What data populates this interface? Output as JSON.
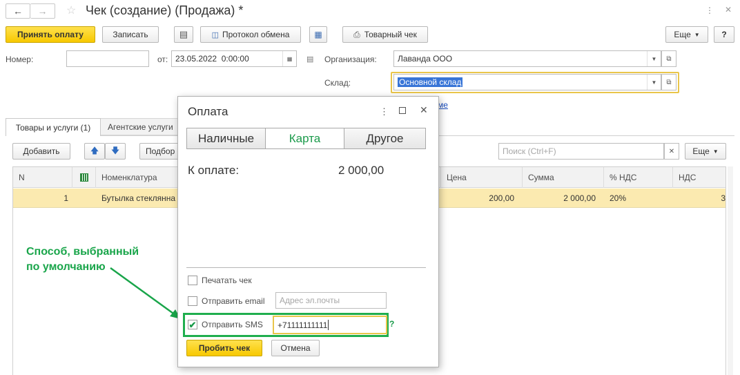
{
  "window": {
    "title": "Чек (создание) (Продажа) *"
  },
  "toolbar": {
    "accept_payment": "Принять оплату",
    "save": "Записать",
    "exchange_log": "Протокол обмена",
    "goods_receipt": "Товарный чек",
    "more": "Еще",
    "help": "?"
  },
  "form": {
    "number_label": "Номер:",
    "number_value": "",
    "from_label": "от:",
    "date_value": "23.05.2022  0:00:00",
    "org_label": "Организация:",
    "org_value": "Лаванда ООО",
    "warehouse_label": "Склад:",
    "warehouse_value": "Основной склад",
    "link_fragment": "ме"
  },
  "tabs": [
    {
      "label": "Товары и услуги (1)"
    },
    {
      "label": "Агентские услуги"
    }
  ],
  "table_toolbar": {
    "add": "Добавить",
    "pick": "Подбор",
    "search_placeholder": "Поиск (Ctrl+F)",
    "more": "Еще"
  },
  "table": {
    "headers": {
      "n": "N",
      "nomenclature": "Номенклатура",
      "price": "Цена",
      "sum": "Сумма",
      "vat_rate": "% НДС",
      "vat": "НДС"
    },
    "rows": [
      {
        "n": "1",
        "nomenclature": "Бутылка стеклянна",
        "price": "200,00",
        "sum": "2 000,00",
        "vat_rate": "20%",
        "vat": "3"
      }
    ]
  },
  "annotation": {
    "line1": "Способ, выбранный",
    "line2": "по умолчанию",
    "color": "#19a54a"
  },
  "dialog": {
    "title": "Оплата",
    "tabs": [
      {
        "label": "Наличные",
        "active": false
      },
      {
        "label": "Карта",
        "active": true
      },
      {
        "label": "Другое",
        "active": false
      }
    ],
    "to_pay_label": "К оплате:",
    "to_pay_value": "2 000,00",
    "print_receipt": "Печатать чек",
    "send_email": "Отправить email",
    "email_placeholder": "Адрес эл.почты",
    "send_sms": "Отправить SMS",
    "sms_value": "+71111111111",
    "hint": "?",
    "submit": "Пробить чек",
    "cancel": "Отмена",
    "accent_color": "#1a9a4a"
  },
  "colors": {
    "yellow_button": "#f7c800",
    "selected_row": "#fbeab0",
    "highlight_border": "#e9c54a",
    "link": "#1c4fbf"
  }
}
